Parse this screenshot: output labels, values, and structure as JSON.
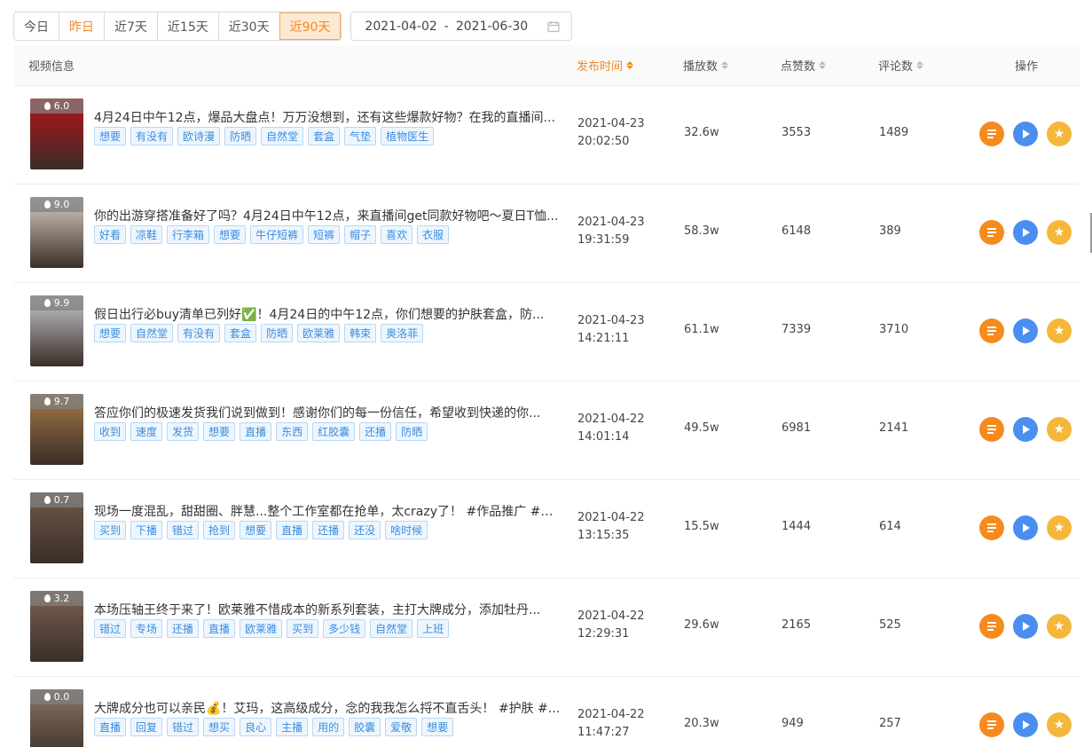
{
  "filters": {
    "ranges": [
      {
        "label": "今日",
        "style": "normal"
      },
      {
        "label": "昨日",
        "style": "orange"
      },
      {
        "label": "近7天",
        "style": "normal"
      },
      {
        "label": "近15天",
        "style": "normal"
      },
      {
        "label": "近30天",
        "style": "normal"
      },
      {
        "label": "近90天",
        "style": "active"
      }
    ],
    "date_start": "2021-04-02",
    "date_sep": "-",
    "date_end": "2021-06-30"
  },
  "columns": {
    "video": "视频信息",
    "publish": "发布时间",
    "plays": "播放数",
    "likes": "点赞数",
    "comments": "评论数",
    "ops": "操作"
  },
  "rows": [
    {
      "score": "6.0",
      "caption": "",
      "thumb_color": "#b5121b",
      "title": "4月24日中午12点，爆品大盘点！万万没想到，还有这些爆款好物？在我的直播间...",
      "tags": [
        "想要",
        "有没有",
        "欧诗漫",
        "防晒",
        "自然堂",
        "套盒",
        "气垫",
        "植物医生"
      ],
      "date": "2021-04-23",
      "time": "20:02:50",
      "plays": "32.6w",
      "likes": "3553",
      "comments": "1489"
    },
    {
      "score": "9.0",
      "caption": "",
      "thumb_color": "#d9cfc3",
      "title": "你的出游穿搭准备好了吗？4月24日中午12点，来直播间get同款好物吧～夏日T恤...",
      "tags": [
        "好看",
        "凉鞋",
        "行李箱",
        "想要",
        "牛仔短裤",
        "短裤",
        "帽子",
        "喜欢",
        "衣服"
      ],
      "date": "2021-04-23",
      "time": "19:31:59",
      "plays": "58.3w",
      "likes": "6148",
      "comments": "389"
    },
    {
      "score": "9.9",
      "caption": "",
      "thumb_color": "#c8c8d0",
      "title": "假日出行必buy清单已列好✅！4月24日的中午12点，你们想要的护肤套盒，防...",
      "tags": [
        "想要",
        "自然堂",
        "有没有",
        "套盒",
        "防晒",
        "欧莱雅",
        "韩束",
        "奥洛菲"
      ],
      "date": "2021-04-23",
      "time": "14:21:11",
      "plays": "61.1w",
      "likes": "7339",
      "comments": "3710"
    },
    {
      "score": "9.7",
      "caption": "",
      "thumb_color": "#a57a48",
      "title": "答应你们的极速发货我们说到做到！感谢你们的每一份信任，希望收到快递的你...",
      "tags": [
        "收到",
        "速度",
        "发货",
        "想要",
        "直播",
        "东西",
        "红胶囊",
        "还播",
        "防晒"
      ],
      "date": "2021-04-22",
      "time": "14:01:14",
      "plays": "49.5w",
      "likes": "6981",
      "comments": "2141"
    },
    {
      "score": "0.7",
      "caption": "",
      "thumb_color": "#6e5a4c",
      "title": "现场一度混乱，甜甜圈、胖慧...整个工作室都在抢单，太crazy了！ #作品推广 #美妆",
      "tags": [
        "买到",
        "下播",
        "错过",
        "抢到",
        "想要",
        "直播",
        "还播",
        "还没",
        "啥时候"
      ],
      "date": "2021-04-22",
      "time": "13:15:35",
      "plays": "15.5w",
      "likes": "1444",
      "comments": "614"
    },
    {
      "score": "3.2",
      "caption": "",
      "thumb_color": "#7a6352",
      "title": "本场压轴王终于来了！欧莱雅不惜成本的新系列套装，主打大牌成分，添加牡丹...",
      "tags": [
        "错过",
        "专场",
        "还播",
        "直播",
        "欧莱雅",
        "买到",
        "多少钱",
        "自然堂",
        "上班"
      ],
      "date": "2021-04-22",
      "time": "12:29:31",
      "plays": "29.6w",
      "likes": "2165",
      "comments": "525"
    },
    {
      "score": "0.0",
      "caption": "",
      "thumb_color": "#8a7662",
      "title": "大牌成分也可以亲民💰！艾玛，这高级成分，念的我我怎么捋不直舌头！ #护肤 #...",
      "tags": [
        "直播",
        "回复",
        "错过",
        "想买",
        "良心",
        "主播",
        "用的",
        "胶囊",
        "爱敬",
        "想要"
      ],
      "date": "2021-04-22",
      "time": "11:47:27",
      "plays": "20.3w",
      "likes": "949",
      "comments": "257"
    }
  ]
}
